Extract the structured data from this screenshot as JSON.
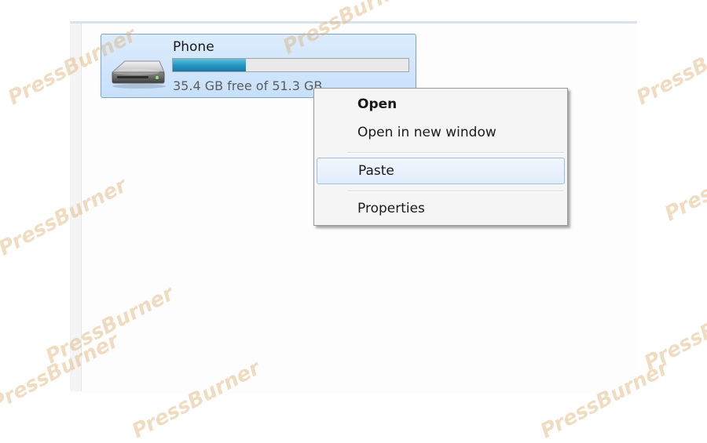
{
  "drive": {
    "name": "Phone",
    "free_text": "35.4 GB free of 51.3 GB",
    "used_fraction": 0.31,
    "icon": "removable-drive-icon"
  },
  "context_menu": {
    "items": [
      {
        "label": "Open",
        "default": true
      },
      {
        "label": "Open in new window"
      },
      {
        "label": "Paste",
        "highlighted": true
      },
      {
        "label": "Properties"
      }
    ]
  },
  "watermark": {
    "text": "PressBurner"
  },
  "colors": {
    "tile_bg": "#cfe4fb",
    "tile_border": "#7da2ce",
    "capacity_fill": "#2a9bc6",
    "menu_bg": "#f5f5f5",
    "menu_highlight_border": "#9ec0e6"
  }
}
